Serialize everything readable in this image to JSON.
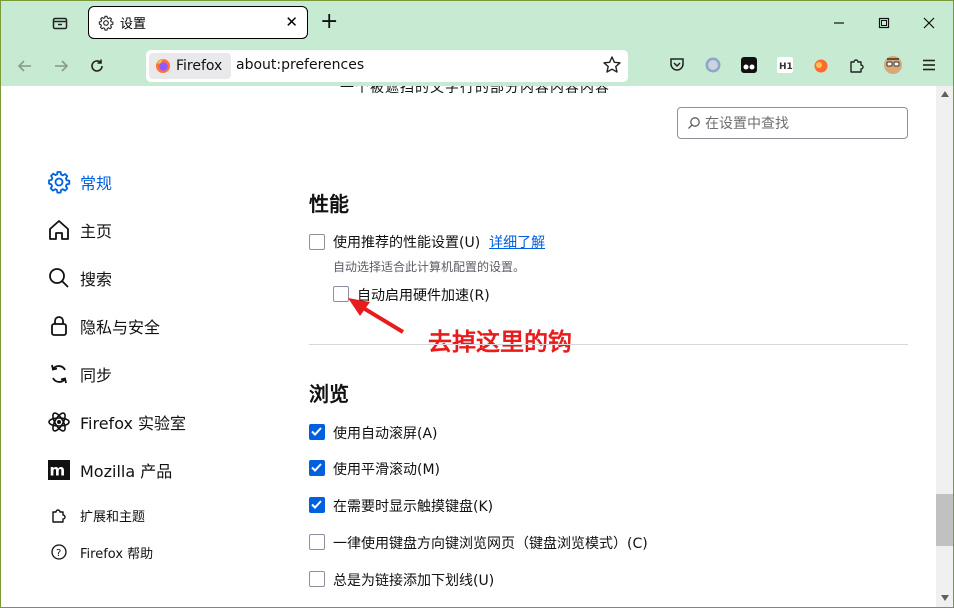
{
  "tab": {
    "title": "设置"
  },
  "toolbar": {
    "identity_label": "Firefox",
    "url": "about:preferences"
  },
  "search": {
    "placeholder": "在设置中查找"
  },
  "partial_top_text": "一个被遮挡的文字行的部分内容内容内容",
  "sidebar": {
    "items": [
      {
        "label": "常规"
      },
      {
        "label": "主页"
      },
      {
        "label": "搜索"
      },
      {
        "label": "隐私与安全"
      },
      {
        "label": "同步"
      },
      {
        "label": "Firefox 实验室"
      },
      {
        "label": "Mozilla 产品"
      }
    ],
    "footer": [
      {
        "label": "扩展和主题"
      },
      {
        "label": "Firefox 帮助"
      }
    ]
  },
  "performance": {
    "heading": "性能",
    "recommended": {
      "label": "使用推荐的性能设置(U)",
      "link": "详细了解",
      "checked": false
    },
    "recommended_desc": "自动选择适合此计算机配置的设置。",
    "hw_accel": {
      "label": "自动启用硬件加速(R)",
      "checked": false
    }
  },
  "annotation": {
    "text": "去掉这里的钩",
    "color": "#e81c1c"
  },
  "browsing": {
    "heading": "浏览",
    "options": [
      {
        "label": "使用自动滚屏(A)",
        "checked": true
      },
      {
        "label": "使用平滑滚动(M)",
        "checked": true
      },
      {
        "label": "在需要时显示触摸键盘(K)",
        "checked": true
      },
      {
        "label": "一律使用键盘方向键浏览网页（键盘浏览模式）(C)",
        "checked": false
      },
      {
        "label": "总是为链接添加下划线(U)",
        "checked": false
      }
    ]
  },
  "colors": {
    "accent": "#0060df",
    "chrome": "#c7ebd2"
  }
}
